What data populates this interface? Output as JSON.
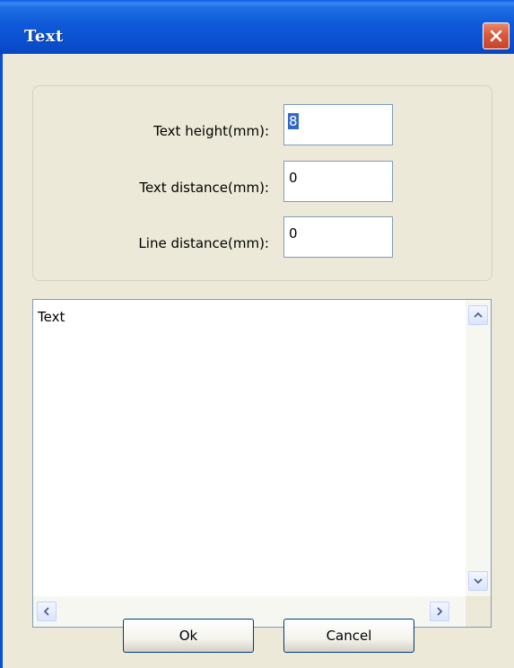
{
  "window": {
    "title": "Text"
  },
  "fields": [
    {
      "label": "Text height(mm):",
      "value": "8"
    },
    {
      "label": "Text distance(mm):",
      "value": "0"
    },
    {
      "label": "Line distance(mm):",
      "value": "0"
    }
  ],
  "textarea": {
    "content": "Text"
  },
  "buttons": {
    "ok": "Ok",
    "cancel": "Cancel"
  },
  "colors": {
    "titlebar": "#0a4fcf",
    "dialog_bg": "#ece9d8",
    "close": "#d9593a",
    "selection": "#316ac5"
  },
  "icons": [
    "close-icon",
    "scroll-up-arrow-icon",
    "scroll-down-arrow-icon",
    "scroll-left-arrow-icon",
    "scroll-right-arrow-icon"
  ]
}
